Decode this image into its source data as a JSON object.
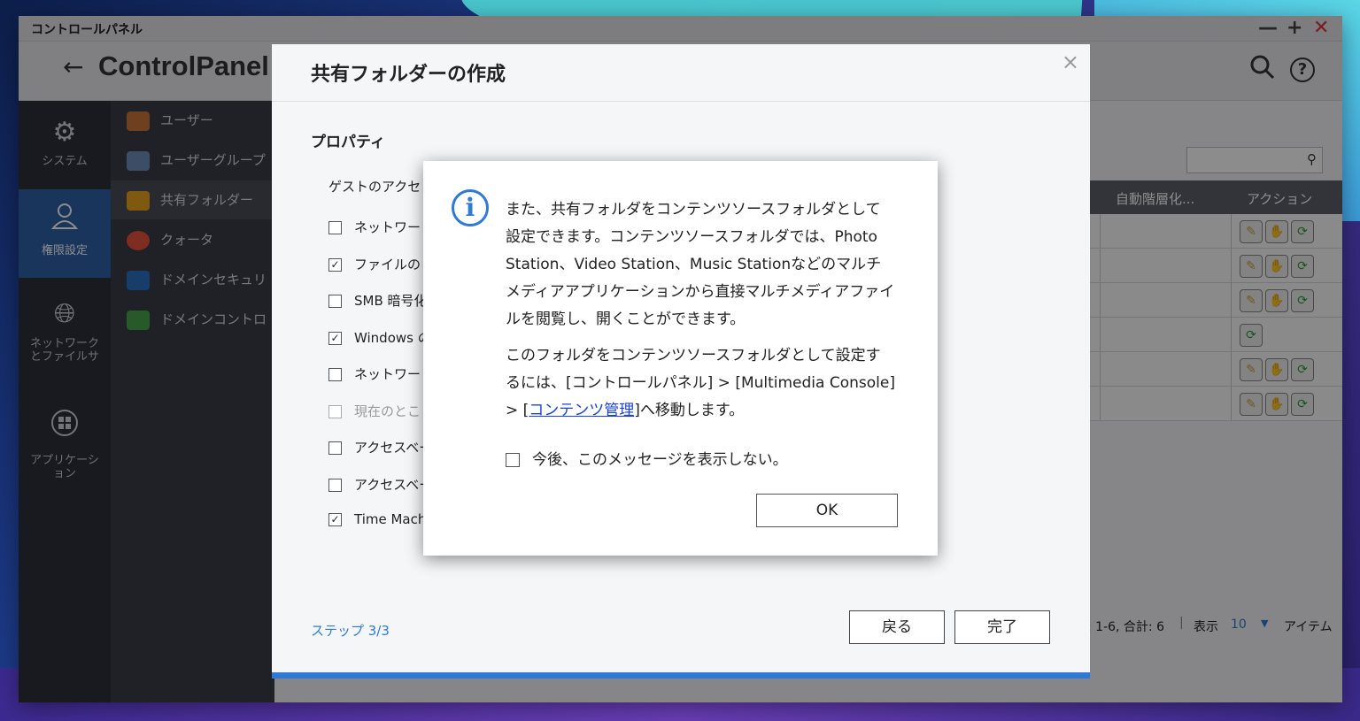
{
  "window": {
    "title": "コントロールパネル",
    "controls": [
      "—",
      "+",
      "✕"
    ]
  },
  "header": {
    "back_icon": "arrow-left-icon",
    "app_name": "ControlPanel",
    "search_icon": "search-icon",
    "help_icon": "help-icon"
  },
  "nav_primary": [
    {
      "label": "システム",
      "icon": "gear-icon"
    },
    {
      "label": "権限設定",
      "icon": "user-icon",
      "selected": true
    },
    {
      "label": "ネットワーク\nとファイルサ",
      "icon": "globe-icon"
    },
    {
      "label": "アプリケーシ\nョン",
      "icon": "apps-icon"
    }
  ],
  "nav_secondary": [
    {
      "label": "ユーザー",
      "color": "#c9763b"
    },
    {
      "label": "ユーザーグループ",
      "color": "#6e8fb8"
    },
    {
      "label": "共有フォルダー",
      "color": "#e8a21c",
      "selected": true
    },
    {
      "label": "クォータ",
      "color": "#e5533b"
    },
    {
      "label": "ドメインセキュリ",
      "color": "#2a6fc4"
    },
    {
      "label": "ドメインコントロ",
      "color": "#4aa34a"
    }
  ],
  "table": {
    "columns": [
      "自動階層化...",
      "アクション"
    ],
    "rows": [
      {
        "actions": [
          "edit",
          "permission",
          "refresh"
        ]
      },
      {
        "actions": [
          "edit",
          "permission",
          "refresh"
        ]
      },
      {
        "actions": [
          "edit",
          "permission",
          "refresh"
        ]
      },
      {
        "actions": [
          "refresh"
        ]
      },
      {
        "actions": [
          "edit",
          "permission",
          "refresh"
        ]
      },
      {
        "actions": [
          "edit",
          "permission",
          "refresh"
        ]
      }
    ],
    "pager": {
      "range": ": 1-6, 合計: 6",
      "show_label": "表示",
      "per_page": "10",
      "items_label": "アイテム"
    }
  },
  "wizard": {
    "title": "共有フォルダーの作成",
    "close": "×",
    "section": "プロパティ",
    "guest_label": "ゲストのアクセ",
    "options": [
      {
        "label": "ネットワー",
        "checked": false,
        "disabled": false
      },
      {
        "label": "ファイルの",
        "checked": true,
        "disabled": false
      },
      {
        "label": "SMB 暗号化",
        "checked": false,
        "disabled": false
      },
      {
        "label": "Windows の",
        "checked": true,
        "disabled": false
      },
      {
        "label": "ネットワー",
        "checked": false,
        "disabled": false
      },
      {
        "label": "現在のとこ",
        "checked": false,
        "disabled": true
      },
      {
        "label": "アクセスベー",
        "checked": false,
        "disabled": false
      },
      {
        "label": "アクセスベー",
        "checked": false,
        "disabled": false
      },
      {
        "label": "Time Machi",
        "checked": true,
        "disabled": false
      }
    ],
    "step": "ステップ 3/3",
    "back_label": "戻る",
    "finish_label": "完了"
  },
  "modal": {
    "info_icon": "i",
    "para1": "また、共有フォルダをコンテンツソースフォルダとして設定できます。コンテンツソースフォルダでは、Photo Station、Video Station、Music Stationなどのマルチメディアアプリケーションから直接マルチメディアファイルを閲覧し、開くことができます。",
    "para2_before": "このフォルダをコンテンツソースフォルダとして設定するには、[コントロールパネル] > [Multimedia Console] > [",
    "para2_link": "コンテンツ管理",
    "para2_after": "]へ移動します。",
    "dont_show": "今後、このメッセージを表示しない。",
    "ok_label": "OK"
  }
}
